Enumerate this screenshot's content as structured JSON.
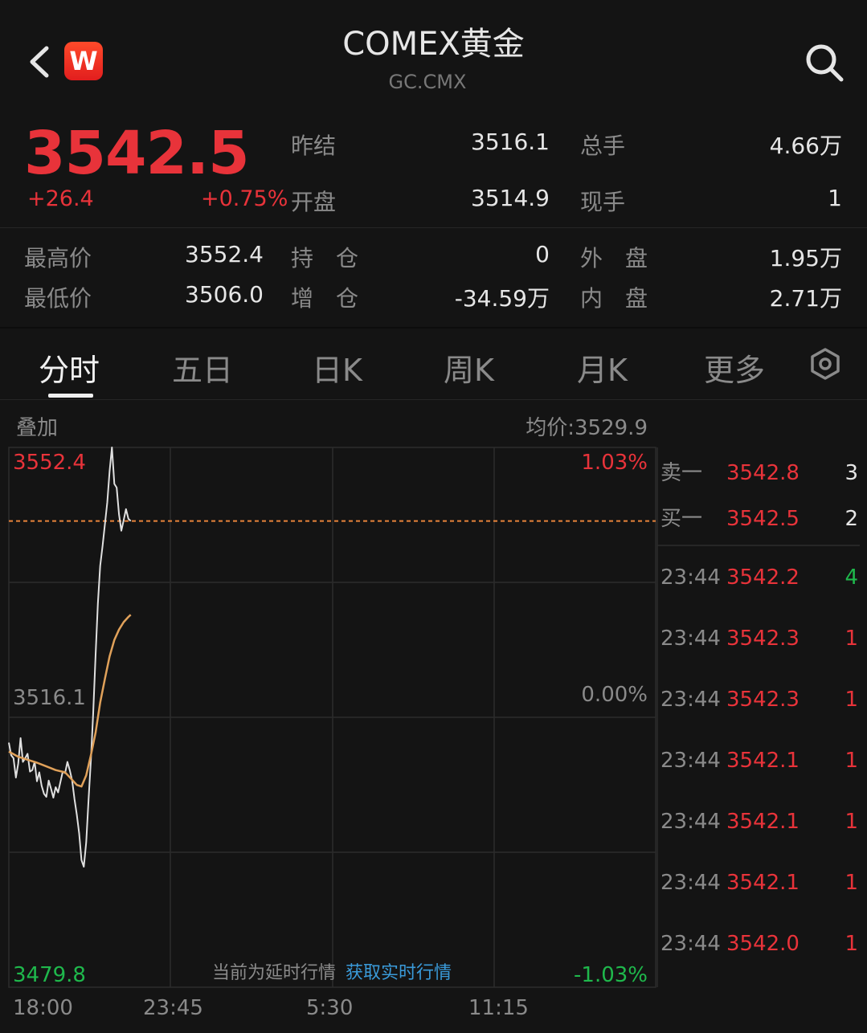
{
  "header": {
    "title": "COMEX黄金",
    "subtitle": "GC.CMX",
    "logo_letter": "W",
    "back_icon": "chevron-left-icon",
    "search_icon": "search-icon"
  },
  "quote": {
    "price": "3542.5",
    "change": "+26.4",
    "change_pct": "+0.75%",
    "colors": {
      "up": "#e8333a",
      "down": "#1fb84c"
    }
  },
  "stats": [
    {
      "label": "昨结",
      "value": "3516.1"
    },
    {
      "label": "总手",
      "value": "4.66万"
    },
    {
      "label": "开盘",
      "value": "3514.9"
    },
    {
      "label": "现手",
      "value": "1"
    },
    {
      "label": "最高价",
      "value": "3552.4"
    },
    {
      "label": "持　仓",
      "value": "0"
    },
    {
      "label": "外　盘",
      "value": "1.95万"
    },
    {
      "label": "最低价",
      "value": "3506.0"
    },
    {
      "label": "增　仓",
      "value": "-34.59万"
    },
    {
      "label": "内　盘",
      "value": "2.71万"
    }
  ],
  "tabs": [
    "分时",
    "五日",
    "日K",
    "周K",
    "月K",
    "更多"
  ],
  "active_tab": "分时",
  "chart_header": {
    "overlay": "叠加",
    "avg_price": "均价:3529.9"
  },
  "notice": {
    "text": "当前为延时行情",
    "link": "获取实时行情"
  },
  "order_book": [
    {
      "label": "卖一",
      "price": "3542.8",
      "vol": "3"
    },
    {
      "label": "买一",
      "price": "3542.5",
      "vol": "2"
    }
  ],
  "ticks": [
    {
      "time": "23:44",
      "price": "3542.2",
      "vol": "4"
    },
    {
      "time": "23:44",
      "price": "3542.3",
      "vol": "1"
    },
    {
      "time": "23:44",
      "price": "3542.3",
      "vol": "1"
    },
    {
      "time": "23:44",
      "price": "3542.1",
      "vol": "1"
    },
    {
      "time": "23:44",
      "price": "3542.1",
      "vol": "1"
    },
    {
      "time": "23:44",
      "price": "3542.1",
      "vol": "1"
    },
    {
      "time": "23:44",
      "price": "3542.0",
      "vol": "1"
    }
  ],
  "chart_data": {
    "type": "line",
    "y_labels": {
      "top": "3552.4",
      "mid": "3516.1",
      "bottom": "3479.8"
    },
    "pct_labels": {
      "top": "1.03%",
      "mid": "0.00%",
      "bottom": "-1.03%"
    },
    "x_labels": [
      "18:00",
      "23:45",
      "5:30",
      "11:15"
    ],
    "ylim": [
      3479.8,
      3552.4
    ],
    "x_range": [
      0,
      1380
    ],
    "prev_settle": 3516.1,
    "last_price": 3542.5,
    "series": [
      {
        "values": [
          [
            0,
            3512.7
          ],
          [
            5,
            3511.0
          ],
          [
            10,
            3510.6
          ],
          [
            15,
            3508.0
          ],
          [
            20,
            3509.9
          ],
          [
            25,
            3513.3
          ],
          [
            30,
            3510.1
          ],
          [
            35,
            3510.6
          ],
          [
            40,
            3511.2
          ],
          [
            45,
            3508.8
          ],
          [
            50,
            3509.0
          ],
          [
            55,
            3510.1
          ],
          [
            60,
            3507.5
          ],
          [
            65,
            3508.7
          ],
          [
            70,
            3506.9
          ],
          [
            75,
            3505.8
          ],
          [
            80,
            3505.4
          ],
          [
            85,
            3507.6
          ],
          [
            90,
            3506.5
          ],
          [
            95,
            3505.3
          ],
          [
            100,
            3506.7
          ],
          [
            105,
            3506.0
          ],
          [
            110,
            3507.4
          ],
          [
            115,
            3508.8
          ],
          [
            120,
            3508.6
          ],
          [
            125,
            3510.1
          ],
          [
            130,
            3509.0
          ],
          [
            135,
            3507.6
          ],
          [
            140,
            3505.1
          ],
          [
            145,
            3503.0
          ],
          [
            150,
            3500.5
          ],
          [
            155,
            3496.9
          ],
          [
            160,
            3496.0
          ],
          [
            165,
            3499.3
          ],
          [
            170,
            3505.0
          ],
          [
            175,
            3510.3
          ],
          [
            180,
            3516.7
          ],
          [
            185,
            3524.3
          ],
          [
            190,
            3531.4
          ],
          [
            195,
            3536.5
          ],
          [
            200,
            3539.2
          ],
          [
            205,
            3542.1
          ],
          [
            210,
            3545.0
          ],
          [
            215,
            3549.2
          ],
          [
            220,
            3552.4
          ],
          [
            225,
            3547.5
          ],
          [
            230,
            3547.0
          ],
          [
            235,
            3543.4
          ],
          [
            240,
            3541.2
          ],
          [
            245,
            3542.6
          ],
          [
            250,
            3544.1
          ],
          [
            255,
            3542.8
          ],
          [
            260,
            3542.5
          ]
        ]
      },
      {
        "values": [
          [
            0,
            3511.5
          ],
          [
            20,
            3510.8
          ],
          [
            40,
            3510.4
          ],
          [
            60,
            3510.0
          ],
          [
            80,
            3509.5
          ],
          [
            100,
            3509.0
          ],
          [
            120,
            3508.7
          ],
          [
            135,
            3507.7
          ],
          [
            145,
            3507.0
          ],
          [
            155,
            3506.8
          ],
          [
            165,
            3508.3
          ],
          [
            175,
            3511.0
          ],
          [
            185,
            3514.0
          ],
          [
            195,
            3518.1
          ],
          [
            205,
            3521.3
          ],
          [
            215,
            3524.3
          ],
          [
            225,
            3526.5
          ],
          [
            235,
            3527.9
          ],
          [
            245,
            3528.9
          ],
          [
            255,
            3529.6
          ],
          [
            260,
            3529.9
          ]
        ]
      }
    ],
    "colors": {
      "price_line": "#e0e0e0",
      "avg_line": "#e0a15a",
      "last_price_line": "#e8833a"
    }
  }
}
